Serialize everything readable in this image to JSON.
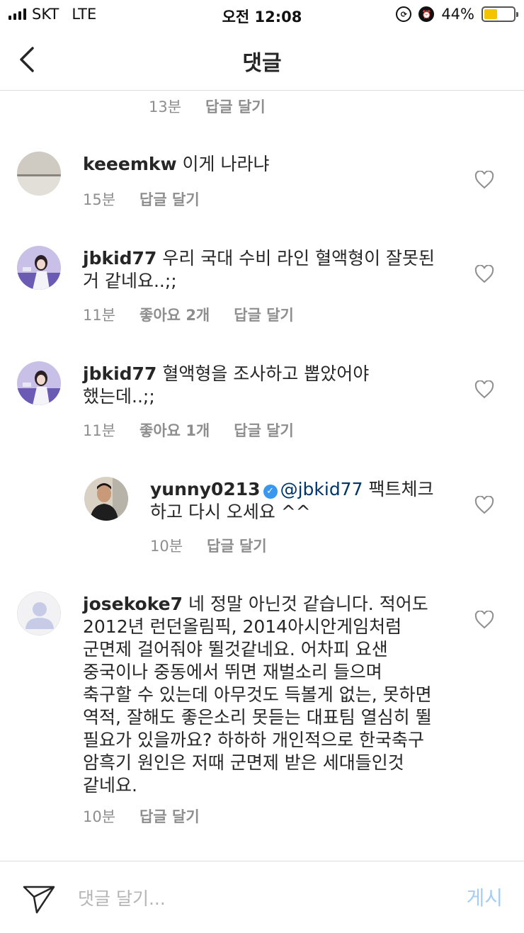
{
  "status_bar": {
    "carrier": "SKT",
    "network": "LTE",
    "time": "오전 12:08",
    "battery": "44%",
    "battery_level": 0.44
  },
  "nav": {
    "title": "댓글",
    "back_icon": "chevron-left-icon"
  },
  "top_partial": {
    "time": "13분",
    "reply_label": "답글 달기"
  },
  "comments": [
    {
      "username": "keeemkw",
      "text": "이게 나라냐",
      "time": "15분",
      "likes": "",
      "reply_label": "답글 달기"
    },
    {
      "username": "jbkid77",
      "text_line1": "우리 국대 수비 라인 혈액형이 잘못된",
      "text_line2": "거 같네요..;;",
      "time": "11분",
      "likes": "좋아요 2개",
      "reply_label": "답글 달기"
    },
    {
      "username": "jbkid77",
      "text_line1": "혈액형을 조사하고 뽑았어야",
      "text_line2": "했는데..;;",
      "time": "11분",
      "likes": "좋아요 1개",
      "reply_label": "답글 달기"
    },
    {
      "username": "yunny0213",
      "mention": "@jbkid77",
      "text_line1": "팩트체크",
      "text_line2": "하고 다시 오세요 ^^",
      "time": "10분",
      "reply_label": "답글 달기"
    },
    {
      "username": "josekoke7",
      "lines": [
        "네 정말 아닌것 같습니다. 적어도",
        "2012년 런던올림픽, 2014아시안게임처럼",
        "군면제 걸어줘야 뛸것같네요. 어차피 요샌",
        "중국이나 중동에서 뛰면 재벌소리 들으며",
        "축구할 수 있는데 아무것도 득볼게 없는, 못하면",
        "역적, 잘해도 좋은소리 못듣는 대표팀 열심히 뛸",
        "필요가 있을까요? 하하하 개인적으로 한국축구",
        "암흑기 원인은 저때 군면제 받은 세대들인것",
        "같네요."
      ],
      "time": "10분",
      "reply_label": "답글 달기"
    }
  ],
  "composer": {
    "placeholder": "댓글 달기...",
    "post_label": "게시",
    "post_color": "#a5cdf5"
  }
}
